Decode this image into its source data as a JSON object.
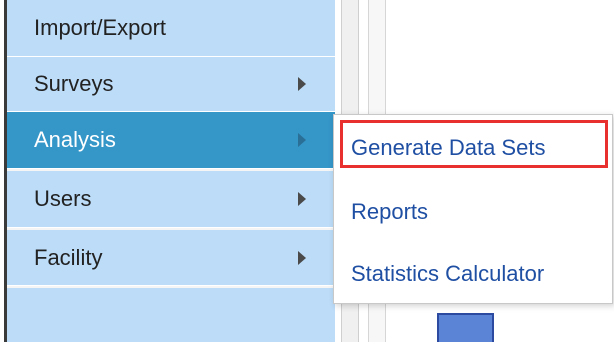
{
  "menu": {
    "items": [
      {
        "label": "Import/Export",
        "has_submenu": false,
        "active": false
      },
      {
        "label": "Surveys",
        "has_submenu": true,
        "active": false
      },
      {
        "label": "Analysis",
        "has_submenu": true,
        "active": true
      },
      {
        "label": "Users",
        "has_submenu": true,
        "active": false
      },
      {
        "label": "Facility",
        "has_submenu": true,
        "active": false
      }
    ]
  },
  "submenu": {
    "items": [
      {
        "label": "Generate Data Sets",
        "highlighted": true
      },
      {
        "label": "Reports",
        "highlighted": false
      },
      {
        "label": "Statistics Calculator",
        "highlighted": false
      }
    ]
  },
  "colors": {
    "menu_item_bg": "#bcdcf8",
    "menu_item_active_bg": "#3596c8",
    "submenu_text": "#1f4fa3",
    "highlight_border": "#e8312f"
  },
  "icons": {
    "submenu_arrow": "caret-right-icon"
  }
}
